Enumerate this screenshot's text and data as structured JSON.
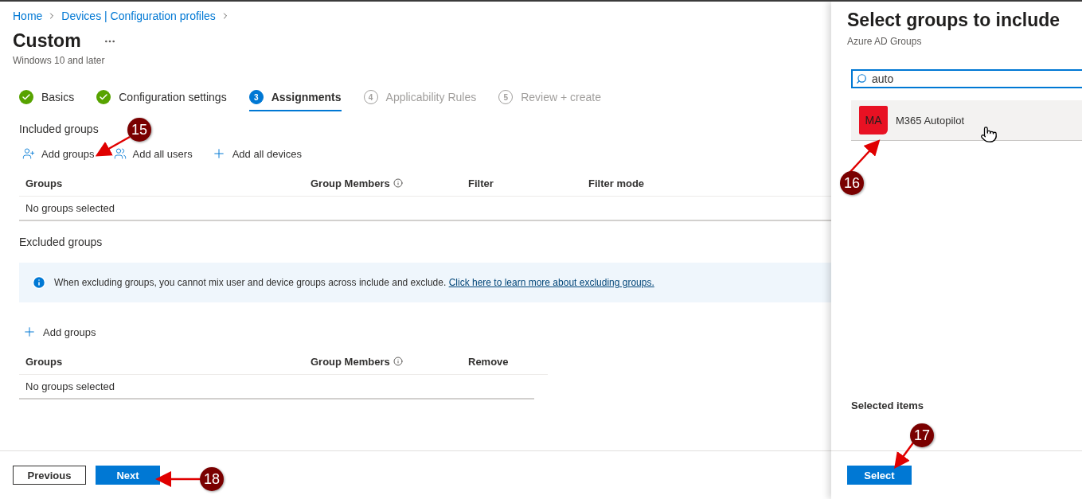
{
  "breadcrumb": [
    {
      "label": "Home"
    },
    {
      "label": "Devices | Configuration profiles"
    }
  ],
  "page": {
    "title": "Custom",
    "subtitle": "Windows 10 and later"
  },
  "steps": [
    {
      "kind": "done",
      "label": "Basics",
      "selected": false
    },
    {
      "kind": "done",
      "label": "Configuration settings",
      "selected": false
    },
    {
      "kind": "current",
      "number": "3",
      "label": "Assignments",
      "selected": true
    },
    {
      "kind": "pending",
      "number": "4",
      "label": "Applicability Rules",
      "selected": false
    },
    {
      "kind": "pending",
      "number": "5",
      "label": "Review + create",
      "selected": false
    }
  ],
  "included": {
    "heading": "Included groups",
    "actions": [
      {
        "kind": "add-group",
        "label": "Add groups"
      },
      {
        "kind": "users",
        "label": "Add all users"
      },
      {
        "kind": "plus",
        "label": "Add all devices"
      }
    ],
    "columns": [
      {
        "kind": "plain",
        "label": "Groups"
      },
      {
        "kind": "info",
        "label": "Group Members"
      },
      {
        "kind": "plain",
        "label": "Filter"
      },
      {
        "kind": "plain",
        "label": "Filter mode"
      }
    ],
    "empty": "No groups selected"
  },
  "excluded": {
    "heading": "Excluded groups",
    "banner": {
      "text": "When excluding groups, you cannot mix user and device groups across include and exclude.",
      "link": "Click here to learn more about excluding groups."
    },
    "actions": [
      {
        "kind": "plus",
        "label": "Add groups"
      }
    ],
    "columns": [
      {
        "kind": "plain",
        "label": "Groups"
      },
      {
        "kind": "info",
        "label": "Group Members"
      },
      {
        "kind": "plain",
        "label": "Remove"
      }
    ],
    "empty": "No groups selected"
  },
  "footer": {
    "buttons": [
      {
        "label": "Previous",
        "kind": "secondary"
      },
      {
        "label": "Next",
        "kind": "primary"
      }
    ]
  },
  "panel": {
    "title": "Select groups to include",
    "subtitle": "Azure AD Groups",
    "search": {
      "value": "auto"
    },
    "results": [
      {
        "initials": "MA",
        "name": "M365 Autopilot",
        "color": "#e81123",
        "selected": false
      }
    ],
    "selected_heading": "Selected items",
    "button": "Select"
  },
  "annotations": [
    {
      "number": "15"
    },
    {
      "number": "16"
    },
    {
      "number": "17"
    },
    {
      "number": "18"
    }
  ]
}
